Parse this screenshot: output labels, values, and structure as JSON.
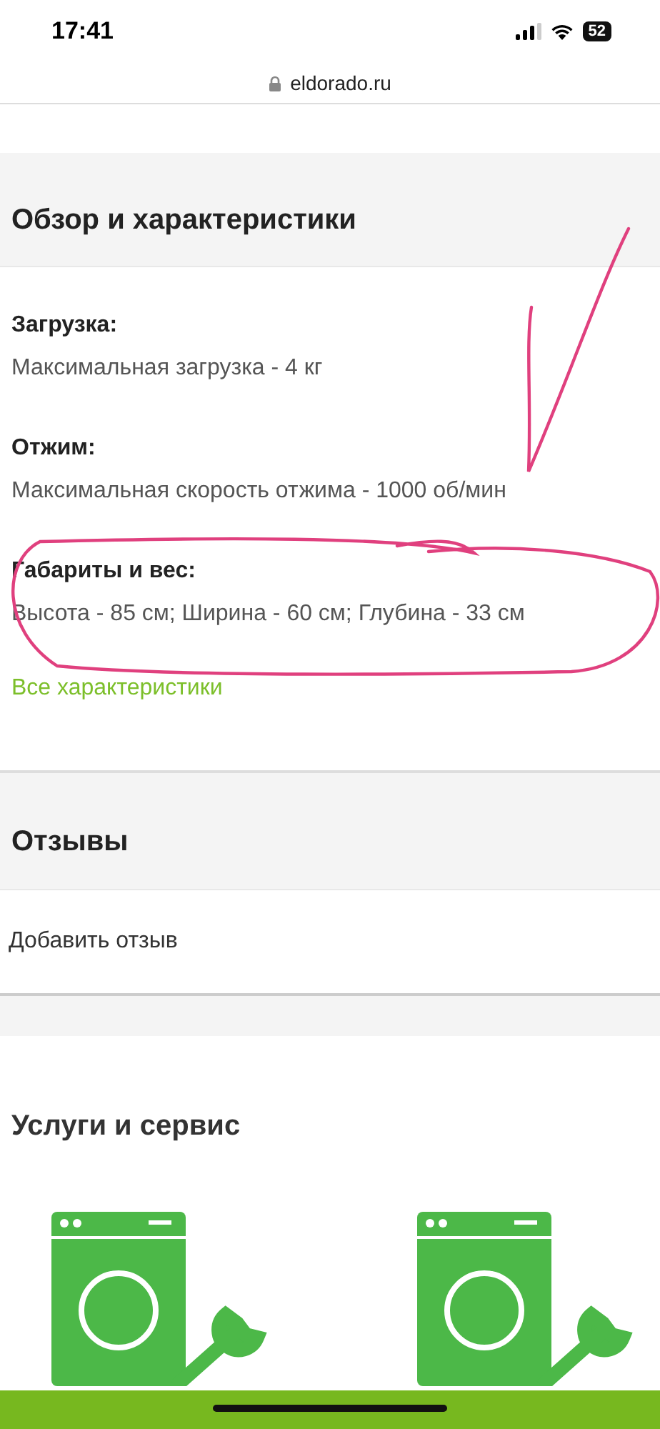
{
  "status_bar": {
    "time": "17:41",
    "battery": "52"
  },
  "address_bar": {
    "url": "eldorado.ru"
  },
  "overview": {
    "title": "Обзор и характеристики",
    "specs": [
      {
        "label": "Загрузка:",
        "value": "Максимальная загрузка - 4 кг"
      },
      {
        "label": "Отжим:",
        "value": "Максимальная скорость отжима - 1000 об/мин"
      },
      {
        "label": "Габариты и вес:",
        "value": "Высота - 85 см; Ширина - 60 см; Глубина - 33 см"
      }
    ],
    "link": "Все характеристики"
  },
  "reviews": {
    "title": "Отзывы",
    "action": "Добавить отзыв"
  },
  "services": {
    "title": "Услуги и сервис"
  }
}
